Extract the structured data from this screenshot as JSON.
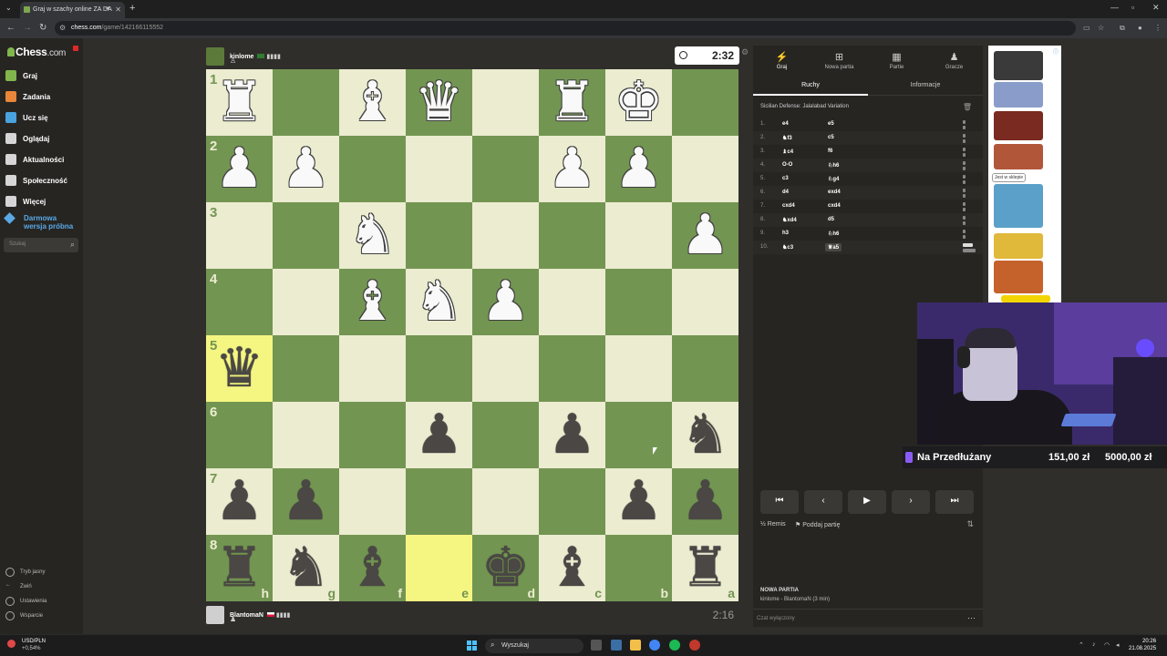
{
  "browser": {
    "tab_title": "Graj w szachy online ZA DA",
    "url_host": "chess.com",
    "url_path": "/game/142166115552"
  },
  "sidebar": {
    "logo": "Chess",
    "logo_suffix": ".com",
    "items": [
      {
        "label": "Graj",
        "icon": "play-pawn-icon",
        "color": "#81b64c"
      },
      {
        "label": "Zadania",
        "icon": "puzzle-icon",
        "color": "#e8863a"
      },
      {
        "label": "Ucz się",
        "icon": "learn-icon",
        "color": "#4aa3df"
      },
      {
        "label": "Oglądaj",
        "icon": "watch-icon",
        "color": "#d6d6d6"
      },
      {
        "label": "Aktualności",
        "icon": "news-icon",
        "color": "#d6d6d6"
      },
      {
        "label": "Społeczność",
        "icon": "community-icon",
        "color": "#d6d6d6"
      },
      {
        "label": "Więcej",
        "icon": "more-icon",
        "color": "#d6d6d6"
      }
    ],
    "trial_line1": "Darmowa",
    "trial_line2": "wersja próbna",
    "search_placeholder": "Szukaj",
    "bottom": [
      "Tryb jasny",
      "Zwiń",
      "Ustawienia",
      "Wsparcie"
    ]
  },
  "game": {
    "top_player": {
      "name": "kinlome",
      "rating": "▮▮▮▮",
      "clock": "2:32"
    },
    "bottom_player": {
      "name": "BlantomaN",
      "rating": "▮▮▮▮",
      "clock": "2:16"
    },
    "rank_labels": [
      "1",
      "2",
      "3",
      "4",
      "5",
      "6",
      "7",
      "8"
    ],
    "file_labels": [
      "h",
      "g",
      "f",
      "e",
      "d",
      "c",
      "b",
      "a"
    ],
    "pieces": [
      {
        "sq": "b1",
        "glyph": "♚",
        "color": "w"
      },
      {
        "sq": "c1",
        "glyph": "♜",
        "color": "w"
      },
      {
        "sq": "e1",
        "glyph": "♛",
        "color": "w"
      },
      {
        "sq": "f1",
        "glyph": "♝",
        "color": "w"
      },
      {
        "sq": "h1",
        "glyph": "♜",
        "color": "w"
      },
      {
        "sq": "b2",
        "glyph": "♟",
        "color": "w"
      },
      {
        "sq": "c2",
        "glyph": "♟",
        "color": "w"
      },
      {
        "sq": "g2",
        "glyph": "♟",
        "color": "w"
      },
      {
        "sq": "h2",
        "glyph": "♟",
        "color": "w"
      },
      {
        "sq": "a3",
        "glyph": "♟",
        "color": "w"
      },
      {
        "sq": "f3",
        "glyph": "♞",
        "color": "w"
      },
      {
        "sq": "d4",
        "glyph": "♟",
        "color": "w"
      },
      {
        "sq": "e4",
        "glyph": "♞",
        "color": "w"
      },
      {
        "sq": "f4",
        "glyph": "♝",
        "color": "w"
      },
      {
        "sq": "h5",
        "glyph": "♛",
        "color": "b"
      },
      {
        "sq": "a6",
        "glyph": "♞",
        "color": "b"
      },
      {
        "sq": "c6",
        "glyph": "♟",
        "color": "b"
      },
      {
        "sq": "e6",
        "glyph": "♟",
        "color": "b"
      },
      {
        "sq": "a7",
        "glyph": "♟",
        "color": "b"
      },
      {
        "sq": "b7",
        "glyph": "♟",
        "color": "b"
      },
      {
        "sq": "g7",
        "glyph": "♟",
        "color": "b"
      },
      {
        "sq": "h7",
        "glyph": "♟",
        "color": "b"
      },
      {
        "sq": "a8",
        "glyph": "♜",
        "color": "b"
      },
      {
        "sq": "c8",
        "glyph": "♝",
        "color": "b"
      },
      {
        "sq": "d8",
        "glyph": "♚",
        "color": "b"
      },
      {
        "sq": "f8",
        "glyph": "♝",
        "color": "b"
      },
      {
        "sq": "g8",
        "glyph": "♞",
        "color": "b"
      },
      {
        "sq": "h8",
        "glyph": "♜",
        "color": "b"
      }
    ],
    "highlights": [
      "h5",
      "e8"
    ]
  },
  "panel": {
    "tabs": [
      {
        "label": "Graj",
        "icon": "bolt-icon"
      },
      {
        "label": "Nowa partia",
        "icon": "plus-icon"
      },
      {
        "label": "Partie",
        "icon": "grid-icon"
      },
      {
        "label": "Gracze",
        "icon": "players-icon"
      }
    ],
    "subtabs": [
      "Ruchy",
      "Informacje"
    ],
    "opening": "Sicilian Defense: Jalalabad Variation",
    "moves": [
      {
        "n": "1.",
        "w": "e4",
        "b": "e5"
      },
      {
        "n": "2.",
        "w": "♞f3",
        "b": "c5"
      },
      {
        "n": "3.",
        "w": "♝c4",
        "b": "f6"
      },
      {
        "n": "4.",
        "w": "O-O",
        "b": "♘h6"
      },
      {
        "n": "5.",
        "w": "c3",
        "b": "♘g4"
      },
      {
        "n": "6.",
        "w": "d4",
        "b": "exd4"
      },
      {
        "n": "7.",
        "w": "cxd4",
        "b": "cxd4"
      },
      {
        "n": "8.",
        "w": "♞xd4",
        "b": "d5"
      },
      {
        "n": "9.",
        "w": "h3",
        "b": "♘h6"
      },
      {
        "n": "10.",
        "w": "♞c3",
        "b": "♕a5"
      }
    ],
    "draw_label": "Remis",
    "resign_label": "Poddaj partię",
    "new_game_title": "NOWA PARTIA",
    "new_game_sub": "kinlome - BlantomaN (3 min)",
    "chat_placeholder": "Czat wyłączony"
  },
  "ad": {
    "badge": "Jest w sklepie"
  },
  "stream": {
    "label": "Na Przedłużany",
    "amount": "151,00 zł",
    "goal": "5000,00 zł"
  },
  "taskbar": {
    "stock_name": "USD/PLN",
    "stock_change": "+0,54%",
    "search_label": "Wyszukaj",
    "time": "20:26",
    "date": "21.08.2025"
  }
}
